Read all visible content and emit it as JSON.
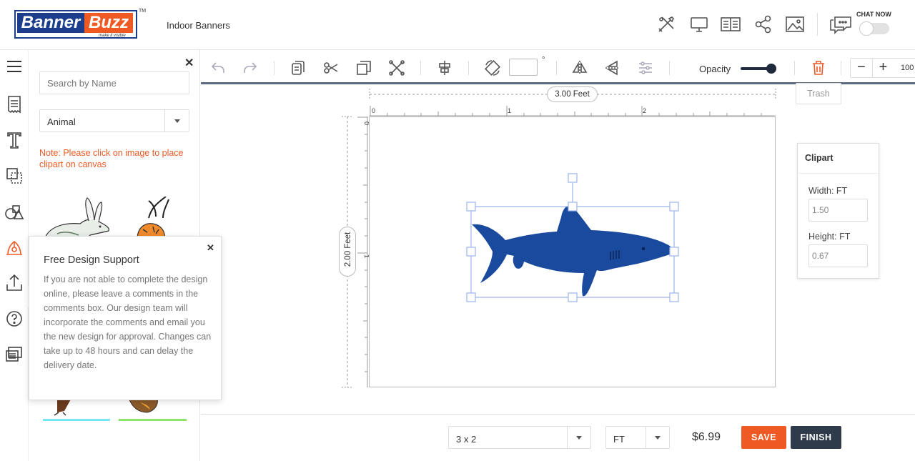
{
  "header": {
    "logo_banner": "Banner",
    "logo_buzz": "Buzz",
    "logo_tagline": "make it visible",
    "logo_tm": "TM",
    "page_name": "Indoor Banners",
    "chat_label": "CHAT NOW",
    "icons": [
      "design-tools-icon",
      "monitor-icon",
      "book-icon",
      "share-icon",
      "image-icon",
      "chat-icon"
    ]
  },
  "rail": {
    "icons": [
      "menu-icon",
      "templates-icon",
      "text-icon",
      "layers-icon",
      "shapes-icon",
      "clipart-icon",
      "upload-icon",
      "help-icon",
      "comments-icon"
    ]
  },
  "panel": {
    "search_placeholder": "Search by Name",
    "category_value": "Animal",
    "note": "Note: Please click on image to place clipart on canvas"
  },
  "popup": {
    "title": "Free Design Support",
    "body": "If you are not able to complete the design online, please leave a comments in the comments box. Our design team will incorporate the comments and email you the new design for approval. Changes can take up to 48 hours and can delay the delivery date."
  },
  "toolbar": {
    "degree_symbol": "°",
    "opacity_label": "Opacity",
    "opacity_value": 1.0,
    "zoom_minus": "−",
    "zoom_plus": "+",
    "zoom_value": "100",
    "trash_tooltip": "Trash"
  },
  "canvas": {
    "width_label": "3.00 Feet",
    "height_label": "2.00 Feet",
    "ruler_x": [
      "0",
      "1",
      "2"
    ],
    "ruler_y": [
      "0",
      "1"
    ],
    "shark_color": "#1a4a9e"
  },
  "clipart_props": {
    "title": "Clipart",
    "width_label": "Width: FT",
    "width_value": "1.50",
    "height_label": "Height: FT",
    "height_value": "0.67"
  },
  "bottom": {
    "size_value": "3 x 2",
    "unit_value": "FT",
    "price": "$6.99",
    "save_label": "SAVE",
    "finish_label": "FINISH"
  },
  "colors": {
    "accent": "#ef5a24",
    "dark": "#2f3a4b",
    "brand_blue": "#1c3d8c"
  }
}
